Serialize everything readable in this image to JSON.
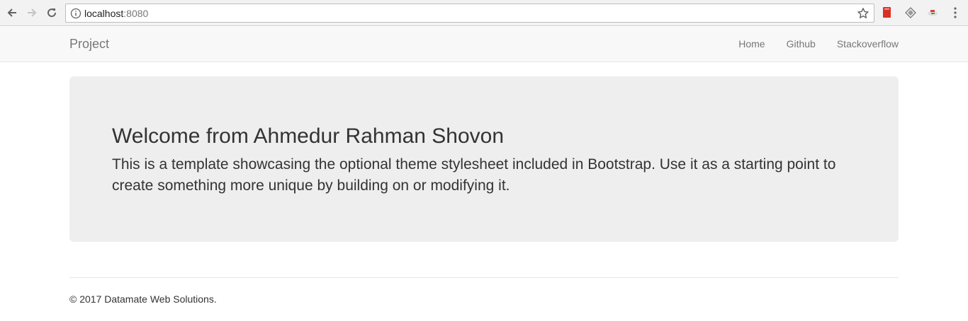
{
  "browser": {
    "url_host": "localhost",
    "url_port": ":8080",
    "icons": [
      "back-icon",
      "forward-icon",
      "reload-icon",
      "info-icon",
      "star-icon",
      "extension-icon",
      "menu-icon"
    ]
  },
  "navbar": {
    "brand": "Project",
    "links": [
      "Home",
      "Github",
      "Stackoverflow"
    ]
  },
  "jumbotron": {
    "heading": "Welcome from Ahmedur Rahman Shovon",
    "text": "This is a template showcasing the optional theme stylesheet included in Bootstrap. Use it as a starting point to create something more unique by building on or modifying it."
  },
  "footer": {
    "text": "© 2017 Datamate Web Solutions."
  },
  "colors": {
    "navbar_bg": "#f8f8f8",
    "jumbotron_bg": "#eeeeee",
    "link": "#777777",
    "text": "#333333"
  }
}
